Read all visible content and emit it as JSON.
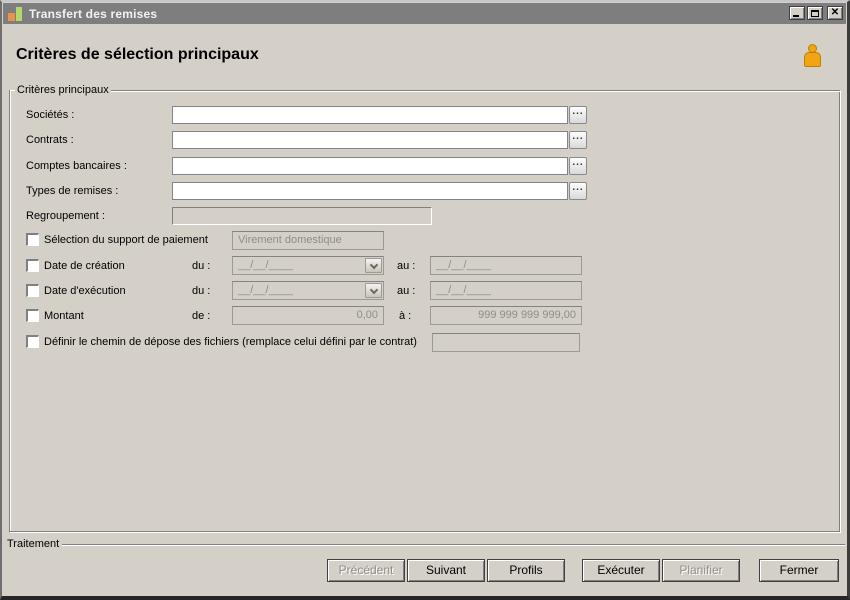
{
  "titlebar": {
    "title": "Transfert des remises",
    "app_icon": "bar-chart-icon",
    "controls": [
      "minimize",
      "maximize",
      "close"
    ]
  },
  "header": {
    "title": "Critères de sélection principaux",
    "person_icon": "user-icon"
  },
  "main_group": {
    "label": "Critères principaux"
  },
  "browse_label": "...",
  "lookup_fields": [
    {
      "label": "Sociétés :",
      "value": ""
    },
    {
      "label": "Contrats :",
      "value": ""
    },
    {
      "label": "Comptes bancaires :",
      "value": ""
    },
    {
      "label": "Types de remises :",
      "value": ""
    }
  ],
  "regroupement": {
    "label": "Regroupement :",
    "value": ""
  },
  "support": {
    "checkbox_label": "Sélection du support de paiement",
    "checked": false,
    "value": "Virement domestique"
  },
  "date_creation": {
    "checkbox_label": "Date de création",
    "checked": false,
    "du_label": "du :",
    "du_value": "__/__/____",
    "au_label": "au :",
    "au_value": "__/__/____"
  },
  "date_execution": {
    "checkbox_label": "Date d'exécution",
    "checked": false,
    "du_label": "du :",
    "du_value": "__/__/____",
    "au_label": "au :",
    "au_value": "__/__/____"
  },
  "montant": {
    "checkbox_label": "Montant",
    "checked": false,
    "de_label": "de :",
    "de_value": "0,00",
    "a_label": "à :",
    "a_value": "999 999 999 999,00"
  },
  "chemin": {
    "checkbox_label": "Définir le chemin de dépose des fichiers (remplace celui défini par le contrat)",
    "checked": false,
    "value": ""
  },
  "bottom_group": {
    "label": "Traitement"
  },
  "buttons": [
    {
      "label": "Précédent",
      "enabled": false
    },
    {
      "label": "Suivant",
      "enabled": true
    },
    {
      "label": "Profils",
      "enabled": true
    },
    {
      "label": "Exécuter",
      "enabled": true
    },
    {
      "label": "Planifier",
      "enabled": false
    },
    {
      "label": "Fermer",
      "enabled": true
    }
  ],
  "colors": {
    "window_bg": "#d4d0c8",
    "titlebar_bg": "#7e7e7e",
    "titlebar_text": "#f2f2f2",
    "person_icon": "#f0a513",
    "icon_orange": "#e8924a",
    "icon_green": "#b3d96a",
    "disabled_text": "#8f8d88",
    "field_border": "#848284"
  }
}
